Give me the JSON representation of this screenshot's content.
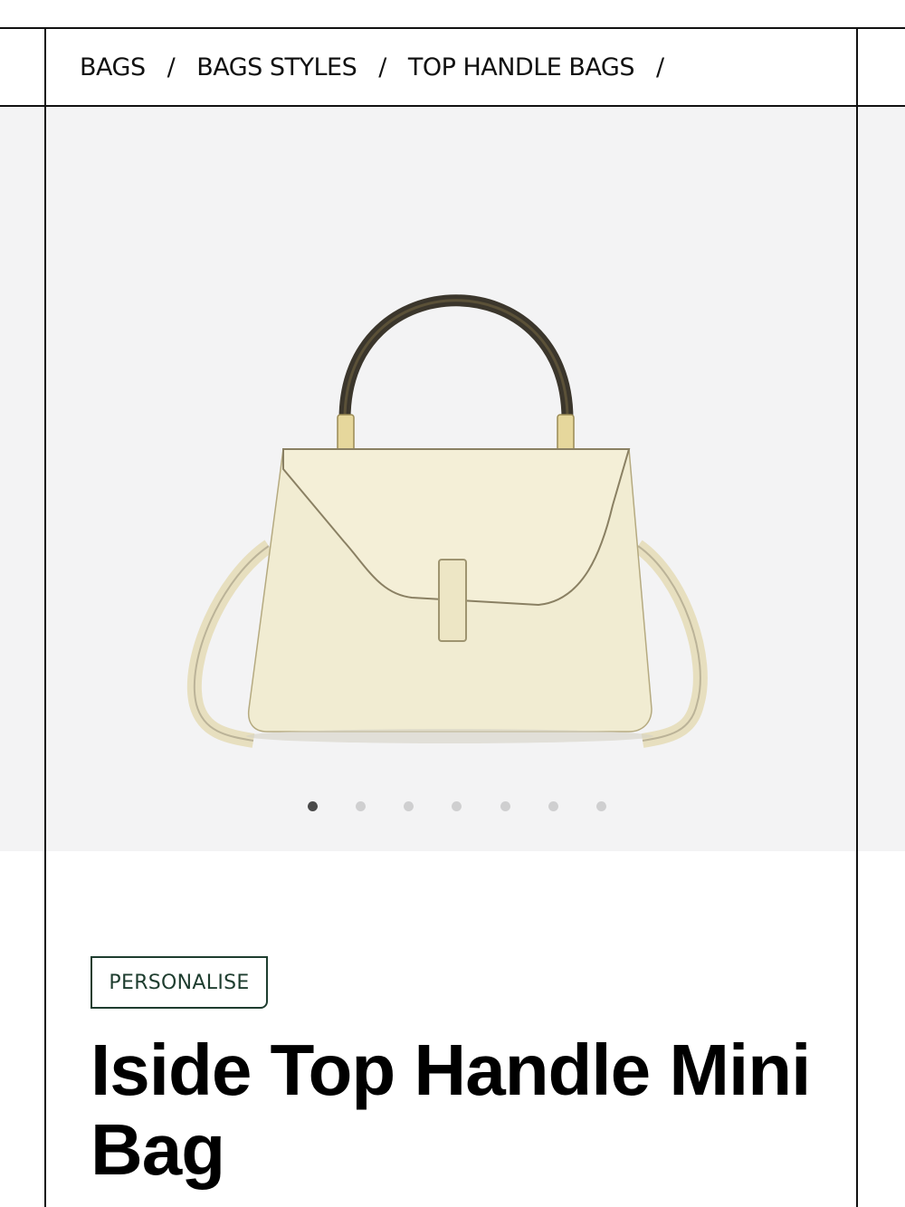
{
  "breadcrumb": {
    "items": [
      {
        "label": "BAGS"
      },
      {
        "label": "BAGS STYLES"
      },
      {
        "label": "TOP HANDLE BAGS"
      }
    ],
    "separator": "/"
  },
  "gallery": {
    "image": "cream-top-handle-bag-image",
    "slide_count": 7,
    "active_index": 0
  },
  "product": {
    "personalise_label": "PERSONALISE",
    "title": "Iside Top Handle Mini Bag"
  },
  "colors": {
    "gallery_bg": "#f3f3f4",
    "bag_cream": "#f1ecd2",
    "accent_green": "#1e3d2f",
    "dot_active": "#4a4a4a",
    "dot_inactive": "#cfcfd0"
  }
}
